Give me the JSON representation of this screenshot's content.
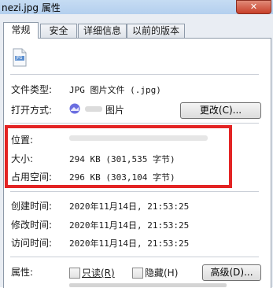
{
  "window": {
    "title": "nezi.jpg 属性",
    "close_label": "✕"
  },
  "tabs": [
    {
      "label": "常规",
      "active": true
    },
    {
      "label": "安全",
      "active": false
    },
    {
      "label": "详细信息",
      "active": false
    },
    {
      "label": "以前的版本",
      "active": false
    }
  ],
  "file": {
    "icon_label": "JPG"
  },
  "fields": {
    "type": {
      "label": "文件类型:",
      "value": "JPG 图片文件 (.jpg)"
    },
    "opens": {
      "label": "打开方式:",
      "value": "图片",
      "button": "更改(C)..."
    },
    "location": {
      "label": "位置:"
    },
    "size": {
      "label": "大小:",
      "value": "294 KB (301,535 字节)"
    },
    "disk": {
      "label": "占用空间:",
      "value": "296 KB (303,104 字节)"
    },
    "created": {
      "label": "创建时间:",
      "value": "2020年11月14日, 21:53:25"
    },
    "modified": {
      "label": "修改时间:",
      "value": "2020年11月14日, 21:53:25"
    },
    "accessed": {
      "label": "访问时间:",
      "value": "2020年11月14日, 21:53:25"
    }
  },
  "attributes": {
    "label": "属性:",
    "readonly": "只读(R)",
    "hidden": "隐藏(H)",
    "advanced_button": "高级(D)..."
  },
  "colors": {
    "highlight": "#e32424",
    "tab_border": "#8e9aa9"
  }
}
